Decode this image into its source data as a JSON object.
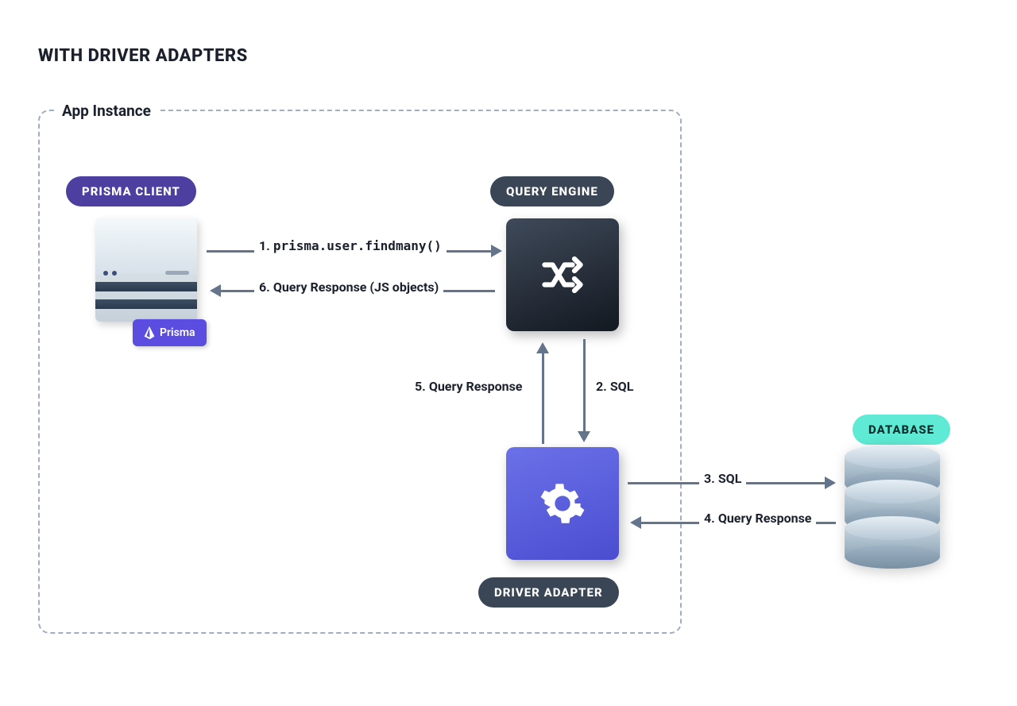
{
  "title": "WITH DRIVER ADAPTERS",
  "appInstance": {
    "label": "App Instance"
  },
  "nodes": {
    "prismaClient": {
      "label": "PRISMA CLIENT",
      "badge": "Prisma"
    },
    "queryEngine": {
      "label": "QUERY ENGINE"
    },
    "driverAdapter": {
      "label": "DRIVER ADAPTER"
    },
    "database": {
      "label": "DATABASE"
    }
  },
  "flows": {
    "f1": {
      "num": "1.",
      "text": "prisma.user.findmany()"
    },
    "f2": {
      "num": "2.",
      "text": "SQL"
    },
    "f3": {
      "num": "3.",
      "text": "SQL"
    },
    "f4": {
      "num": "4.",
      "text": "Query Response"
    },
    "f5": {
      "num": "5.",
      "text": "Query Response"
    },
    "f6": {
      "num": "6.",
      "text": "Query Response (JS objects)"
    }
  }
}
